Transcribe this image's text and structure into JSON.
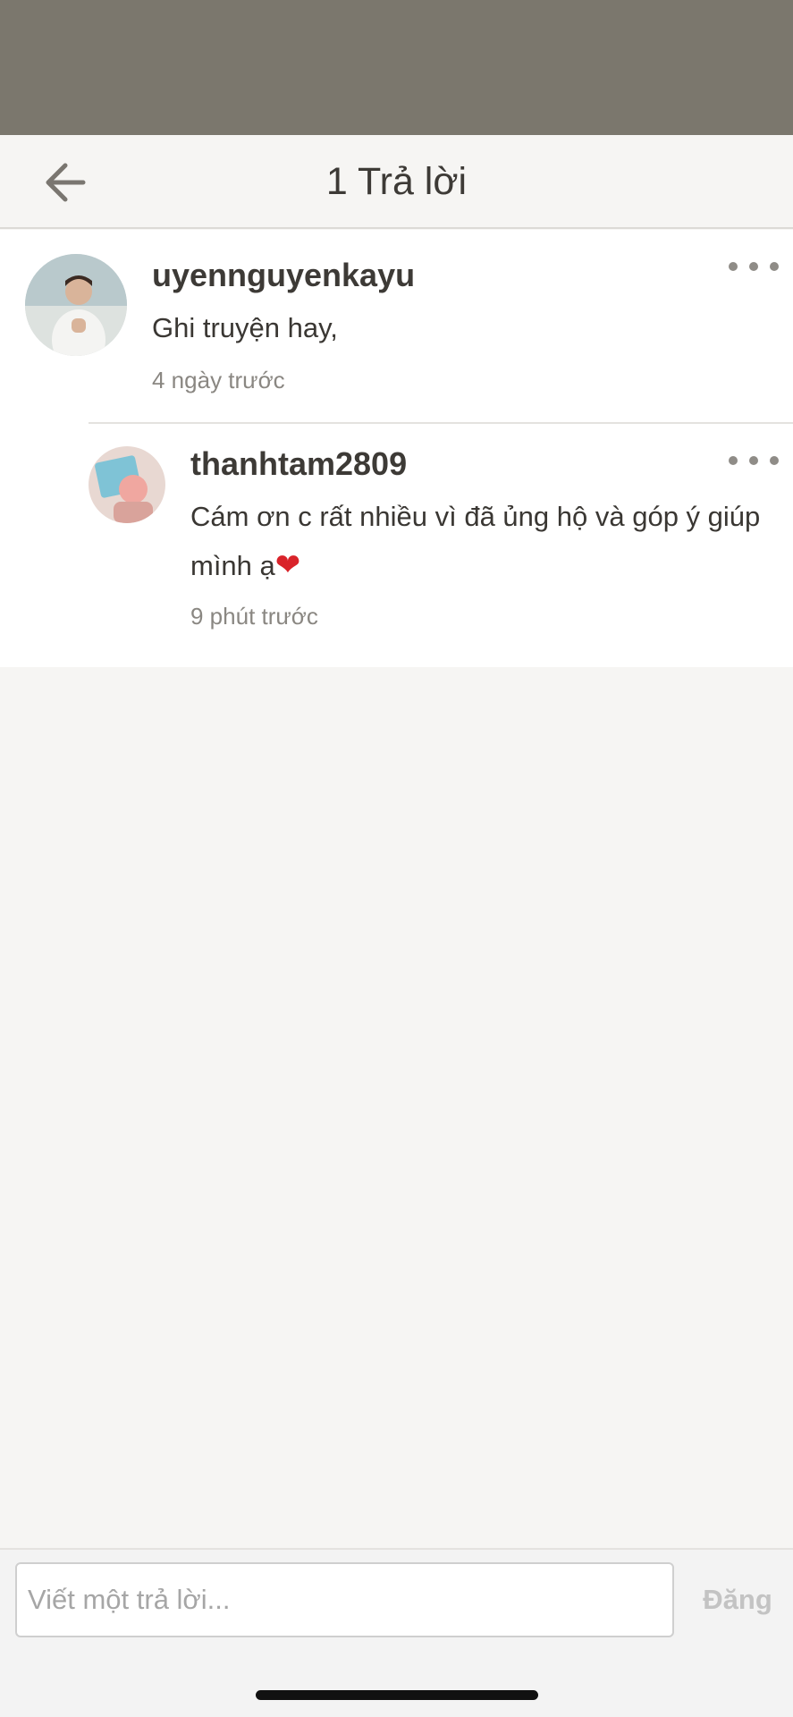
{
  "header": {
    "title": "1 Trả lời",
    "back_icon": "arrow-left-icon"
  },
  "comments": [
    {
      "username": "uyennguyenkayu",
      "text": "Ghi truyện hay,",
      "time": "4 ngày trước",
      "avatar": "user-avatar-photo"
    },
    {
      "username": "thanhtam2809",
      "text": "Cám ơn c rất nhiều vì đã ủng hộ và góp ý giúp mình ạ",
      "emoji": "❤",
      "time": "9 phút trước",
      "avatar": "user-avatar-photo"
    }
  ],
  "compose": {
    "placeholder": "Viết một trả lời...",
    "post_label": "Đăng"
  },
  "colors": {
    "status_bar": "#7b776d",
    "background": "#f6f5f3",
    "text": "#3d3a36",
    "muted": "#8a8782",
    "heart": "#d9232a"
  }
}
